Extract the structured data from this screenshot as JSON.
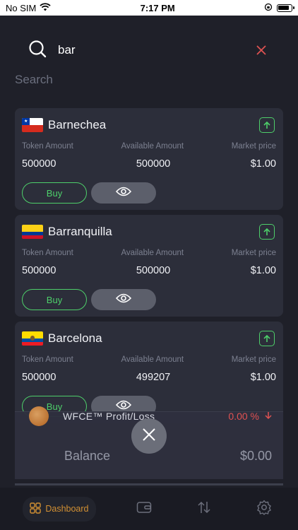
{
  "status_bar": {
    "carrier": "No SIM",
    "time": "7:17 PM",
    "icons": [
      "wifi-icon",
      "orientation-lock-icon",
      "battery-icon"
    ]
  },
  "search": {
    "query": "bar",
    "label": "Search",
    "icon": "search-icon",
    "clear_icon": "close-icon"
  },
  "colors": {
    "background": "#1f2029",
    "card": "#2c2e3a",
    "accent_green": "#4ecf6a",
    "accent_red": "#e05252",
    "accent_orange": "#d29033"
  },
  "columns": {
    "token": "Token Amount",
    "available": "Available Amount",
    "price": "Market price"
  },
  "results": [
    {
      "city": "Barnechea",
      "flag": "chile-flag",
      "token_amount": "500000",
      "available_amount": "500000",
      "market_price": "$1.00",
      "buy_label": "Buy"
    },
    {
      "city": "Barranquilla",
      "flag": "colombia-flag",
      "token_amount": "500000",
      "available_amount": "500000",
      "market_price": "$1.00",
      "buy_label": "Buy"
    },
    {
      "city": "Barcelona",
      "flag": "ecuador-flag",
      "token_amount": "500000",
      "available_amount": "499207",
      "market_price": "$1.00",
      "buy_label": "Buy"
    }
  ],
  "summary": {
    "profit_label": "WFCE™ Profit/Loss",
    "profit_value": "0.00 %",
    "balance_label": "Balance",
    "balance_value": "$0.00"
  },
  "tabs": [
    {
      "label": "Dashboard",
      "icon": "dashboard-icon"
    },
    {
      "label": "",
      "icon": "wallet-icon"
    },
    {
      "label": "",
      "icon": "transfer-icon"
    },
    {
      "label": "",
      "icon": "settings-icon"
    }
  ]
}
